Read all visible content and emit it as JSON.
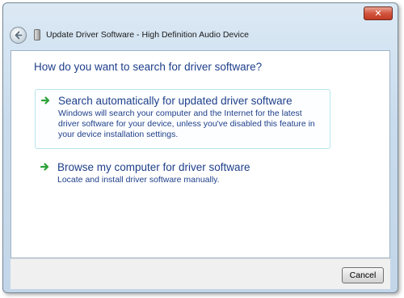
{
  "window": {
    "title": "Update Driver Software - High Definition Audio Device",
    "close_label": "✕"
  },
  "content": {
    "heading": "How do you want to search for driver software?",
    "options": [
      {
        "title": "Search automatically for updated driver software",
        "description": "Windows will search your computer and the Internet for the latest driver software for your device, unless you've disabled this feature in your device installation settings.",
        "icon": "green-arrow-icon",
        "selected": true
      },
      {
        "title": "Browse my computer for driver software",
        "description": "Locate and install driver software manually.",
        "icon": "green-arrow-icon",
        "selected": false
      }
    ]
  },
  "footer": {
    "cancel_label": "Cancel"
  },
  "colors": {
    "link_blue": "#1e3f8a",
    "arrow_green": "#2ea33a",
    "selection_border": "#b7e6ee"
  }
}
